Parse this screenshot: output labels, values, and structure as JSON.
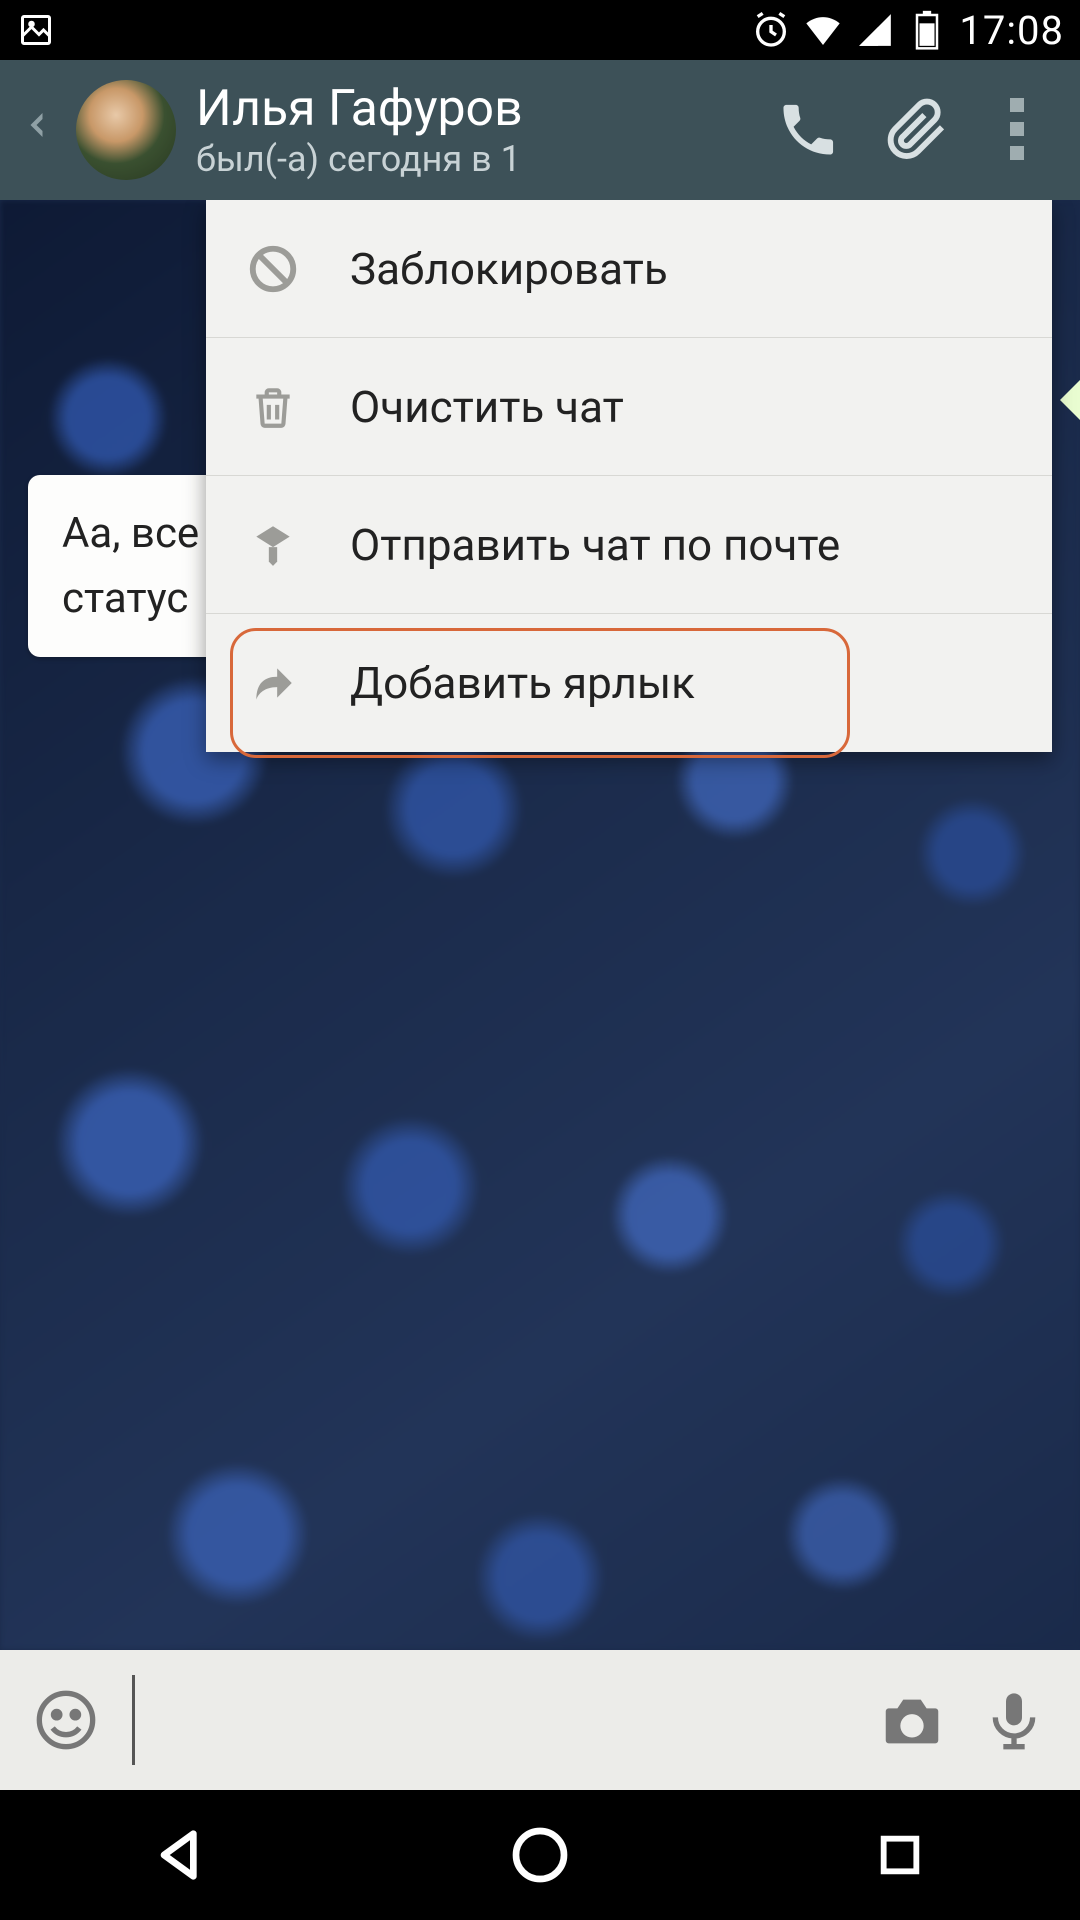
{
  "status": {
    "time": "17:08"
  },
  "header": {
    "contact_name": "Илья Гафуров",
    "contact_status": "был(-а) сегодня в 1"
  },
  "menu": {
    "items": [
      {
        "icon": "block-icon",
        "label": "Заблокировать"
      },
      {
        "icon": "trash-icon",
        "label": "Очистить чат"
      },
      {
        "icon": "mail-icon",
        "label": "Отправить чат по почте"
      },
      {
        "icon": "shortcut-icon",
        "label": "Добавить ярлык"
      }
    ],
    "highlighted_index": 3
  },
  "chat": {
    "incoming_line1": "Аа, все",
    "incoming_line2": "статус"
  },
  "input": {
    "placeholder": ""
  }
}
